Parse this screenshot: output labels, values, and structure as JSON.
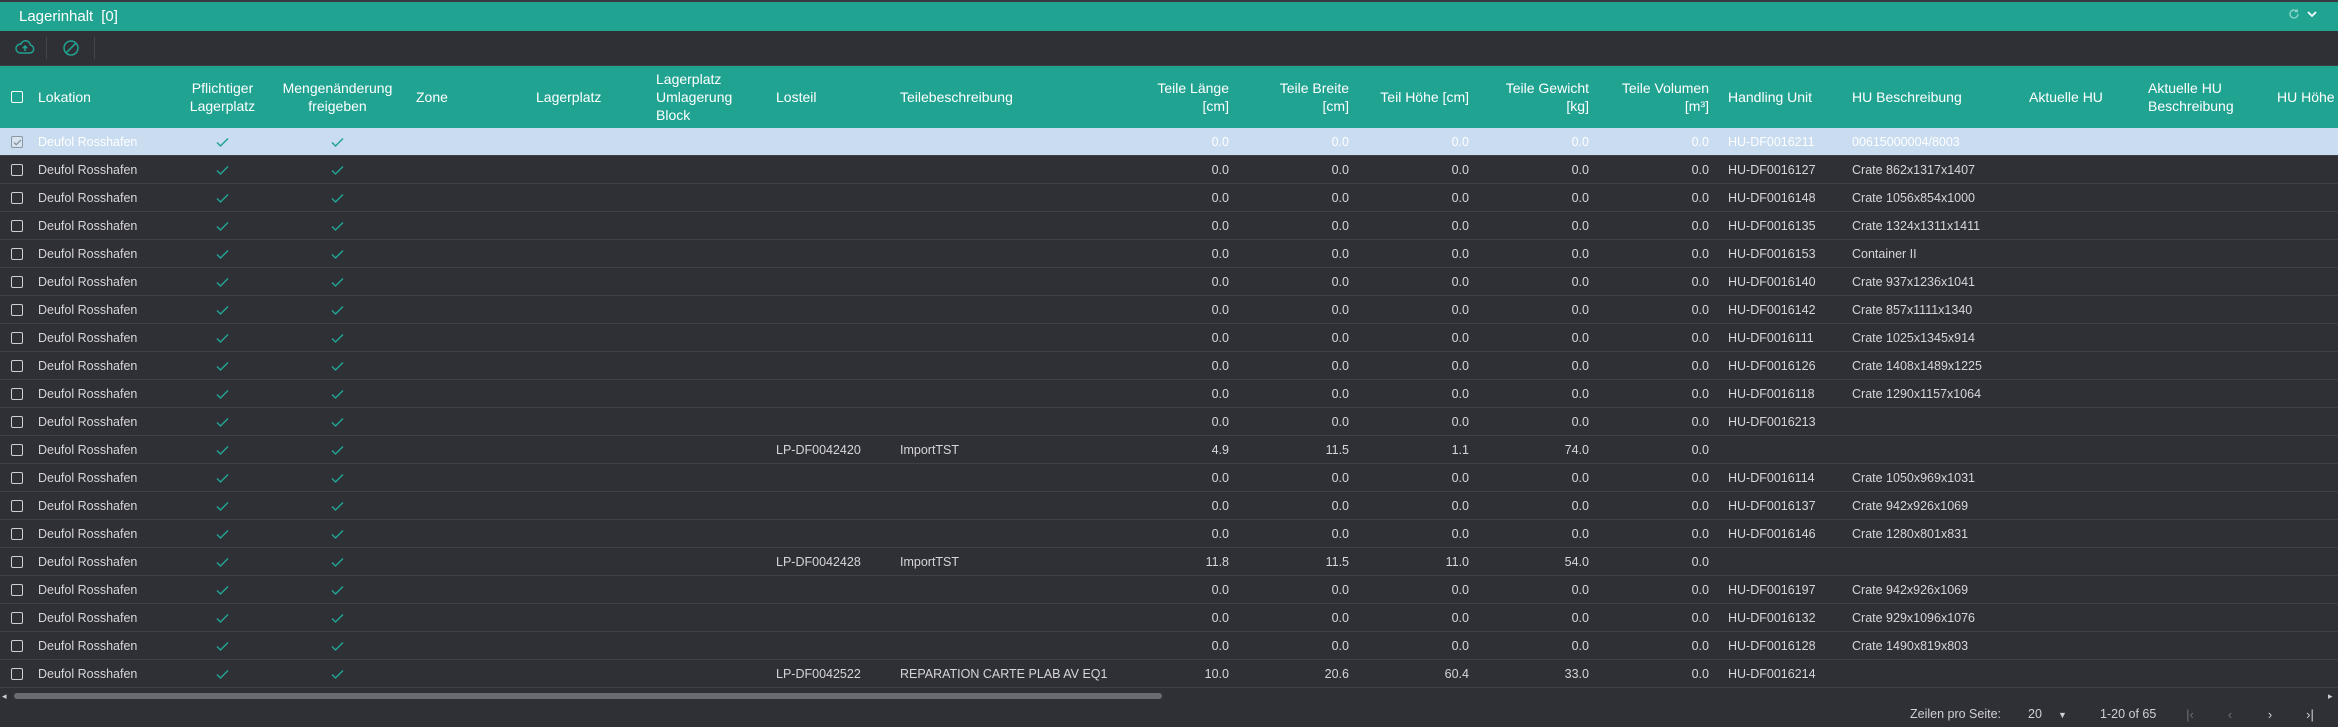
{
  "panel": {
    "title": "Lagerinhalt",
    "count": "[0]"
  },
  "columns": {
    "lokation": "Lokation",
    "pflichtiger": "Pflichtiger Lagerplatz",
    "mengen": "Mengenänderung freigeben",
    "zone": "Zone",
    "lagerplatz": "Lagerplatz",
    "umlagerung": "Lagerplatz Umlagerung Block",
    "losteil": "Losteil",
    "teilebeschreibung": "Teilebeschreibung",
    "laenge": "Teile Länge [cm]",
    "breite": "Teile Breite [cm]",
    "hoehe": "Teil Höhe [cm]",
    "gewicht": "Teile Gewicht [kg]",
    "volumen": "Teile Volumen [m³]",
    "hu": "Handling Unit",
    "hu_beschreibung": "HU Beschreibung",
    "aktuelle_hu": "Aktuelle HU",
    "aktuelle_hu_beschreibung": "Aktuelle HU Beschreibung",
    "hu_hoehe": "HU Höhe"
  },
  "rows": [
    {
      "lokation": "Deufol Rosshafen",
      "losteil": "",
      "beschreibung": "",
      "laenge": "0.0",
      "breite": "0.0",
      "hoehe": "0.0",
      "gewicht": "0.0",
      "volumen": "0.0",
      "hu": "HU-DF0016211",
      "hu_beschreibung": "00615000004/8003",
      "selected": true
    },
    {
      "lokation": "Deufol Rosshafen",
      "losteil": "",
      "beschreibung": "",
      "laenge": "0.0",
      "breite": "0.0",
      "hoehe": "0.0",
      "gewicht": "0.0",
      "volumen": "0.0",
      "hu": "HU-DF0016127",
      "hu_beschreibung": "Crate 862x1317x1407"
    },
    {
      "lokation": "Deufol Rosshafen",
      "losteil": "",
      "beschreibung": "",
      "laenge": "0.0",
      "breite": "0.0",
      "hoehe": "0.0",
      "gewicht": "0.0",
      "volumen": "0.0",
      "hu": "HU-DF0016148",
      "hu_beschreibung": "Crate 1056x854x1000"
    },
    {
      "lokation": "Deufol Rosshafen",
      "losteil": "",
      "beschreibung": "",
      "laenge": "0.0",
      "breite": "0.0",
      "hoehe": "0.0",
      "gewicht": "0.0",
      "volumen": "0.0",
      "hu": "HU-DF0016135",
      "hu_beschreibung": "Crate 1324x1311x1411"
    },
    {
      "lokation": "Deufol Rosshafen",
      "losteil": "",
      "beschreibung": "",
      "laenge": "0.0",
      "breite": "0.0",
      "hoehe": "0.0",
      "gewicht": "0.0",
      "volumen": "0.0",
      "hu": "HU-DF0016153",
      "hu_beschreibung": "Container II"
    },
    {
      "lokation": "Deufol Rosshafen",
      "losteil": "",
      "beschreibung": "",
      "laenge": "0.0",
      "breite": "0.0",
      "hoehe": "0.0",
      "gewicht": "0.0",
      "volumen": "0.0",
      "hu": "HU-DF0016140",
      "hu_beschreibung": "Crate 937x1236x1041"
    },
    {
      "lokation": "Deufol Rosshafen",
      "losteil": "",
      "beschreibung": "",
      "laenge": "0.0",
      "breite": "0.0",
      "hoehe": "0.0",
      "gewicht": "0.0",
      "volumen": "0.0",
      "hu": "HU-DF0016142",
      "hu_beschreibung": "Crate 857x1111x1340"
    },
    {
      "lokation": "Deufol Rosshafen",
      "losteil": "",
      "beschreibung": "",
      "laenge": "0.0",
      "breite": "0.0",
      "hoehe": "0.0",
      "gewicht": "0.0",
      "volumen": "0.0",
      "hu": "HU-DF0016111",
      "hu_beschreibung": "Crate 1025x1345x914"
    },
    {
      "lokation": "Deufol Rosshafen",
      "losteil": "",
      "beschreibung": "",
      "laenge": "0.0",
      "breite": "0.0",
      "hoehe": "0.0",
      "gewicht": "0.0",
      "volumen": "0.0",
      "hu": "HU-DF0016126",
      "hu_beschreibung": "Crate 1408x1489x1225"
    },
    {
      "lokation": "Deufol Rosshafen",
      "losteil": "",
      "beschreibung": "",
      "laenge": "0.0",
      "breite": "0.0",
      "hoehe": "0.0",
      "gewicht": "0.0",
      "volumen": "0.0",
      "hu": "HU-DF0016118",
      "hu_beschreibung": "Crate 1290x1157x1064"
    },
    {
      "lokation": "Deufol Rosshafen",
      "losteil": "",
      "beschreibung": "",
      "laenge": "0.0",
      "breite": "0.0",
      "hoehe": "0.0",
      "gewicht": "0.0",
      "volumen": "0.0",
      "hu": "HU-DF0016213",
      "hu_beschreibung": ""
    },
    {
      "lokation": "Deufol Rosshafen",
      "losteil": "LP-DF0042420",
      "beschreibung": "ImportTST",
      "laenge": "4.9",
      "breite": "11.5",
      "hoehe": "1.1",
      "gewicht": "74.0",
      "volumen": "0.0",
      "hu": "",
      "hu_beschreibung": ""
    },
    {
      "lokation": "Deufol Rosshafen",
      "losteil": "",
      "beschreibung": "",
      "laenge": "0.0",
      "breite": "0.0",
      "hoehe": "0.0",
      "gewicht": "0.0",
      "volumen": "0.0",
      "hu": "HU-DF0016114",
      "hu_beschreibung": "Crate 1050x969x1031"
    },
    {
      "lokation": "Deufol Rosshafen",
      "losteil": "",
      "beschreibung": "",
      "laenge": "0.0",
      "breite": "0.0",
      "hoehe": "0.0",
      "gewicht": "0.0",
      "volumen": "0.0",
      "hu": "HU-DF0016137",
      "hu_beschreibung": "Crate 942x926x1069"
    },
    {
      "lokation": "Deufol Rosshafen",
      "losteil": "",
      "beschreibung": "",
      "laenge": "0.0",
      "breite": "0.0",
      "hoehe": "0.0",
      "gewicht": "0.0",
      "volumen": "0.0",
      "hu": "HU-DF0016146",
      "hu_beschreibung": "Crate 1280x801x831"
    },
    {
      "lokation": "Deufol Rosshafen",
      "losteil": "LP-DF0042428",
      "beschreibung": "ImportTST",
      "laenge": "11.8",
      "breite": "11.5",
      "hoehe": "11.0",
      "gewicht": "54.0",
      "volumen": "0.0",
      "hu": "",
      "hu_beschreibung": ""
    },
    {
      "lokation": "Deufol Rosshafen",
      "losteil": "",
      "beschreibung": "",
      "laenge": "0.0",
      "breite": "0.0",
      "hoehe": "0.0",
      "gewicht": "0.0",
      "volumen": "0.0",
      "hu": "HU-DF0016197",
      "hu_beschreibung": "Crate 942x926x1069"
    },
    {
      "lokation": "Deufol Rosshafen",
      "losteil": "",
      "beschreibung": "",
      "laenge": "0.0",
      "breite": "0.0",
      "hoehe": "0.0",
      "gewicht": "0.0",
      "volumen": "0.0",
      "hu": "HU-DF0016132",
      "hu_beschreibung": "Crate 929x1096x1076"
    },
    {
      "lokation": "Deufol Rosshafen",
      "losteil": "",
      "beschreibung": "",
      "laenge": "0.0",
      "breite": "0.0",
      "hoehe": "0.0",
      "gewicht": "0.0",
      "volumen": "0.0",
      "hu": "HU-DF0016128",
      "hu_beschreibung": "Crate 1490x819x803"
    },
    {
      "lokation": "Deufol Rosshafen",
      "losteil": "LP-DF0042522",
      "beschreibung": "REPARATION CARTE PLAB AV EQ1",
      "laenge": "10.0",
      "breite": "20.6",
      "hoehe": "60.4",
      "gewicht": "33.0",
      "volumen": "0.0",
      "hu": "HU-DF0016214",
      "hu_beschreibung": ""
    }
  ],
  "pager": {
    "rows_per_page_label": "Zeilen pro Seite:",
    "rows_per_page_value": "20",
    "range": "1-20 of 65"
  },
  "colors": {
    "accent": "#21a392",
    "background": "#2f2f36",
    "selected_row": "#c9dcf0"
  },
  "icons": {
    "refresh": "refresh-icon",
    "collapse": "chevron-down-icon",
    "upload": "cloud-upload-icon",
    "cancel": "cancel-icon"
  }
}
